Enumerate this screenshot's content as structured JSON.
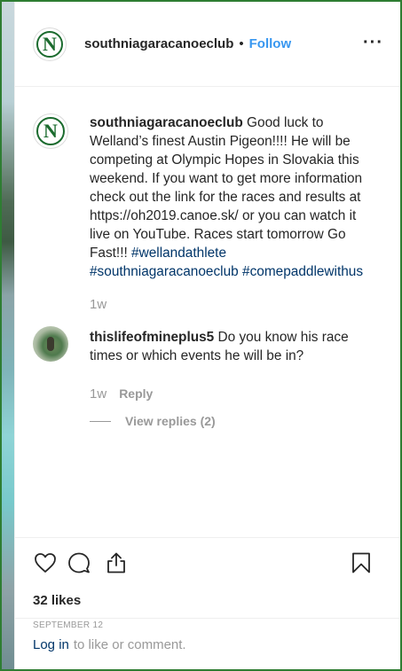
{
  "header": {
    "username": "southniagaracanoeclub",
    "separator": "•",
    "follow_label": "Follow",
    "more_label": "···"
  },
  "caption": {
    "username": "southniagaracanoeclub",
    "text": "Good luck to Welland’s finest Austin Pigeon!!!! He will be competing at Olympic Hopes in Slovakia this weekend. If you want to get more information check out the link for the races and results at https://oh2019.canoe.sk/ or you can watch it live on YouTube. Races start tomorrow Go Fast!!!",
    "hashtags": [
      "#wellandathlete",
      "#southniagaracanoeclub",
      "#comepaddlewithus"
    ],
    "age": "1w"
  },
  "comment": {
    "username": "thislifeofmineplus5",
    "text": "Do you know his race times or which events he will be in?",
    "age": "1w",
    "reply_label": "Reply",
    "view_replies_label": "View replies (2)"
  },
  "icons": {
    "like": "heart-icon",
    "comment": "comment-bubble-icon",
    "share": "share-upload-icon",
    "save": "bookmark-icon"
  },
  "likes_label": "32 likes",
  "date_label": "SEPTEMBER 12",
  "login": {
    "link_label": "Log in",
    "rest_label": "to like or comment."
  }
}
